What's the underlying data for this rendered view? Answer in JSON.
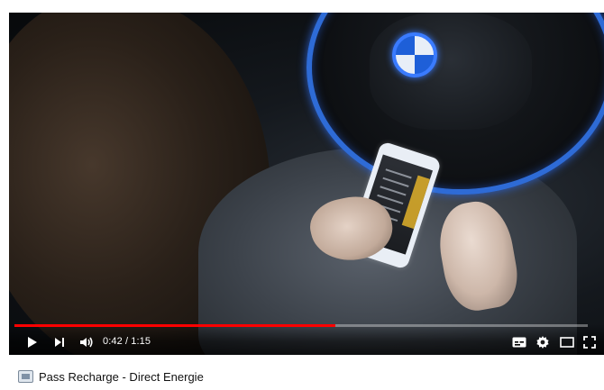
{
  "video": {
    "playback": {
      "current_time": "0:42",
      "duration": "1:15",
      "progress_fraction": 0.56
    },
    "controls": {
      "icons": [
        "play-icon",
        "next-icon",
        "volume-icon",
        "subtitles-icon",
        "gear-icon",
        "theater-mode-icon",
        "fullscreen-icon"
      ]
    },
    "colors": {
      "progress_played": "#ff0000",
      "accent_blue": "#2e6bd6"
    }
  },
  "document": {
    "title": "Pass Recharge - Direct Energie"
  }
}
